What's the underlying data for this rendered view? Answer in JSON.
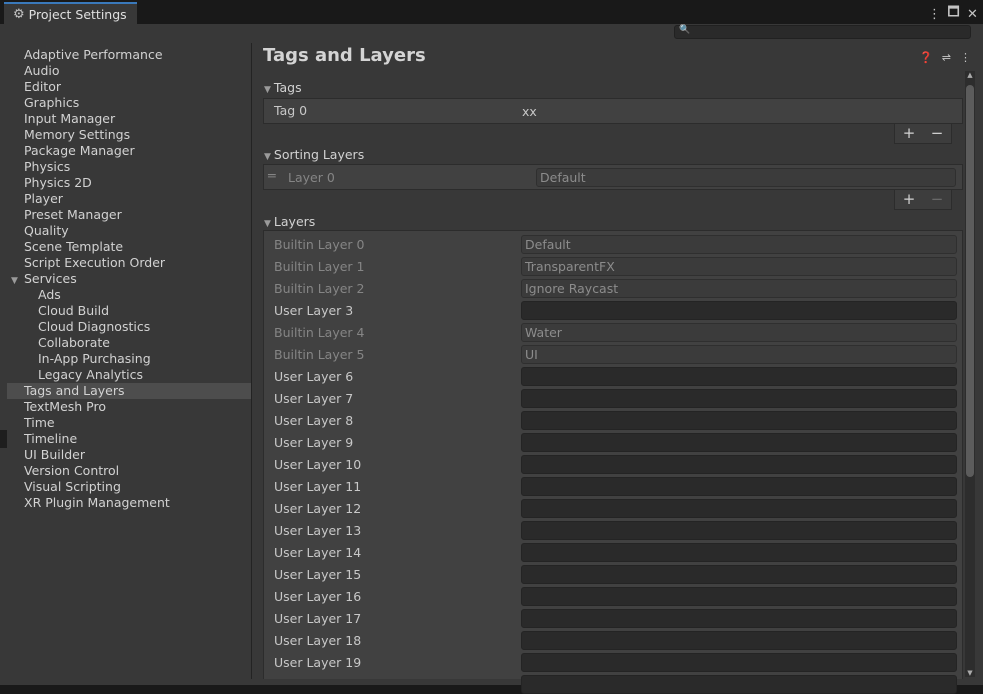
{
  "window": {
    "title": "Project Settings"
  },
  "sidebar": {
    "items": [
      {
        "label": "Adaptive Performance"
      },
      {
        "label": "Audio"
      },
      {
        "label": "Editor"
      },
      {
        "label": "Graphics"
      },
      {
        "label": "Input Manager"
      },
      {
        "label": "Memory Settings"
      },
      {
        "label": "Package Manager"
      },
      {
        "label": "Physics"
      },
      {
        "label": "Physics 2D"
      },
      {
        "label": "Player"
      },
      {
        "label": "Preset Manager"
      },
      {
        "label": "Quality"
      },
      {
        "label": "Scene Template"
      },
      {
        "label": "Script Execution Order"
      },
      {
        "label": "Services",
        "expanded": true
      },
      {
        "label": "Ads",
        "child": true
      },
      {
        "label": "Cloud Build",
        "child": true
      },
      {
        "label": "Cloud Diagnostics",
        "child": true
      },
      {
        "label": "Collaborate",
        "child": true
      },
      {
        "label": "In-App Purchasing",
        "child": true
      },
      {
        "label": "Legacy Analytics",
        "child": true
      },
      {
        "label": "Tags and Layers",
        "selected": true
      },
      {
        "label": "TextMesh Pro"
      },
      {
        "label": "Time"
      },
      {
        "label": "Timeline"
      },
      {
        "label": "UI Builder"
      },
      {
        "label": "Version Control"
      },
      {
        "label": "Visual Scripting"
      },
      {
        "label": "XR Plugin Management"
      }
    ]
  },
  "main": {
    "title": "Tags and Layers",
    "tags": {
      "header": "Tags",
      "rows": [
        {
          "label": "Tag 0",
          "value": "xx"
        }
      ]
    },
    "sorting_layers": {
      "header": "Sorting Layers",
      "rows": [
        {
          "label": "Layer 0",
          "value": "Default"
        }
      ]
    },
    "layers": {
      "header": "Layers",
      "rows": [
        {
          "label": "Builtin Layer 0",
          "value": "Default",
          "builtin": true
        },
        {
          "label": "Builtin Layer 1",
          "value": "TransparentFX",
          "builtin": true
        },
        {
          "label": "Builtin Layer 2",
          "value": "Ignore Raycast",
          "builtin": true
        },
        {
          "label": "User Layer 3",
          "value": "",
          "builtin": false
        },
        {
          "label": "Builtin Layer 4",
          "value": "Water",
          "builtin": true
        },
        {
          "label": "Builtin Layer 5",
          "value": "UI",
          "builtin": true
        },
        {
          "label": "User Layer 6",
          "value": "",
          "builtin": false
        },
        {
          "label": "User Layer 7",
          "value": "",
          "builtin": false
        },
        {
          "label": "User Layer 8",
          "value": "",
          "builtin": false
        },
        {
          "label": "User Layer 9",
          "value": "",
          "builtin": false
        },
        {
          "label": "User Layer 10",
          "value": "",
          "builtin": false
        },
        {
          "label": "User Layer 11",
          "value": "",
          "builtin": false
        },
        {
          "label": "User Layer 12",
          "value": "",
          "builtin": false
        },
        {
          "label": "User Layer 13",
          "value": "",
          "builtin": false
        },
        {
          "label": "User Layer 14",
          "value": "",
          "builtin": false
        },
        {
          "label": "User Layer 15",
          "value": "",
          "builtin": false
        },
        {
          "label": "User Layer 16",
          "value": "",
          "builtin": false
        },
        {
          "label": "User Layer 17",
          "value": "",
          "builtin": false
        },
        {
          "label": "User Layer 18",
          "value": "",
          "builtin": false
        },
        {
          "label": "User Layer 19",
          "value": "",
          "builtin": false
        },
        {
          "label": "",
          "value": "",
          "builtin": false
        }
      ]
    }
  },
  "icons": {
    "settings": "gear-icon",
    "menu": "kebab-menu-icon",
    "maximize": "maximize-icon",
    "close": "close-icon",
    "search": "search-icon",
    "help": "help-icon",
    "preset": "preset-sliders-icon",
    "more": "more-menu-icon",
    "add": "plus-icon",
    "remove": "minus-icon",
    "drag": "drag-handle-icon"
  },
  "colors": {
    "accent": "#3a79bb",
    "selection": "#4d4d4d",
    "panel": "#383838"
  }
}
